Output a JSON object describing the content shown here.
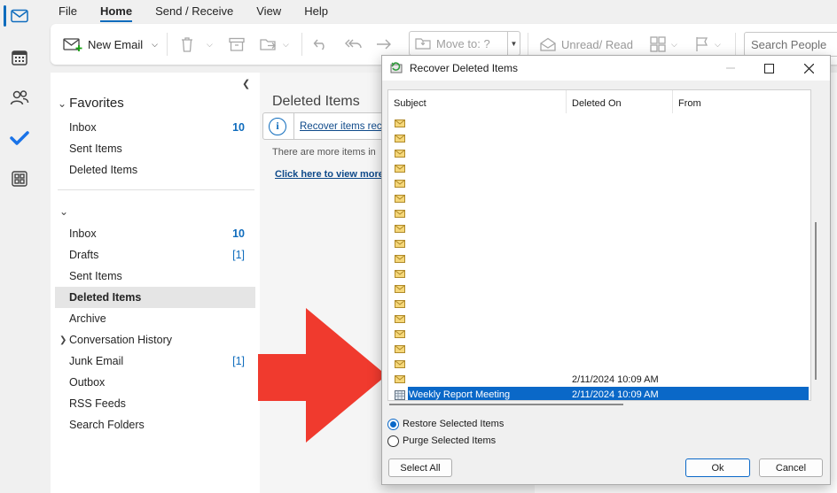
{
  "rail": {
    "items": [
      {
        "name": "mail-icon",
        "active": true
      },
      {
        "name": "calendar-icon",
        "active": false
      },
      {
        "name": "people-icon",
        "active": false
      },
      {
        "name": "todo-icon",
        "active": false
      },
      {
        "name": "apps-icon",
        "active": false
      }
    ]
  },
  "menu": {
    "items": [
      "File",
      "Home",
      "Send / Receive",
      "View",
      "Help"
    ],
    "active": "Home"
  },
  "ribbon": {
    "new_email": "New Email",
    "move_to": "Move to: ?",
    "unread_read": "Unread/ Read",
    "search_placeholder": "Search People"
  },
  "folders": {
    "favorites_label": "Favorites",
    "favorites": [
      {
        "label": "Inbox",
        "count": "10"
      },
      {
        "label": "Sent Items",
        "count": ""
      },
      {
        "label": "Deleted Items",
        "count": ""
      }
    ],
    "account": [
      {
        "label": "Inbox",
        "count": "10"
      },
      {
        "label": "Drafts",
        "count": "[1]"
      },
      {
        "label": "Sent Items",
        "count": ""
      },
      {
        "label": "Deleted Items",
        "count": "",
        "selected": true
      },
      {
        "label": "Archive",
        "count": ""
      },
      {
        "label": "Conversation History",
        "count": "",
        "expandable": true
      },
      {
        "label": "Junk Email",
        "count": "[1]"
      },
      {
        "label": "Outbox",
        "count": ""
      },
      {
        "label": "RSS Feeds",
        "count": ""
      },
      {
        "label": "Search Folders",
        "count": ""
      }
    ]
  },
  "message_list": {
    "title": "Deleted Items",
    "info_link": "Recover items rece",
    "more_text": "There are more items in",
    "click_link": "Click here to view more"
  },
  "dialog": {
    "title": "Recover Deleted Items",
    "columns": [
      "Subject",
      "Deleted On",
      "From"
    ],
    "empty_rows": 17,
    "rows": [
      {
        "subject": "",
        "deleted_on": "2/11/2024 10:09 AM",
        "from": "",
        "selected": false
      },
      {
        "subject": "Weekly Report Meeting",
        "deleted_on": "2/11/2024 10:09 AM",
        "from": "",
        "selected": true,
        "icon": "meeting-icon"
      }
    ],
    "options": [
      {
        "label": "Restore Selected Items",
        "checked": true
      },
      {
        "label": "Purge Selected Items",
        "checked": false
      }
    ],
    "select_all": "Select All",
    "ok": "Ok",
    "cancel": "Cancel"
  }
}
